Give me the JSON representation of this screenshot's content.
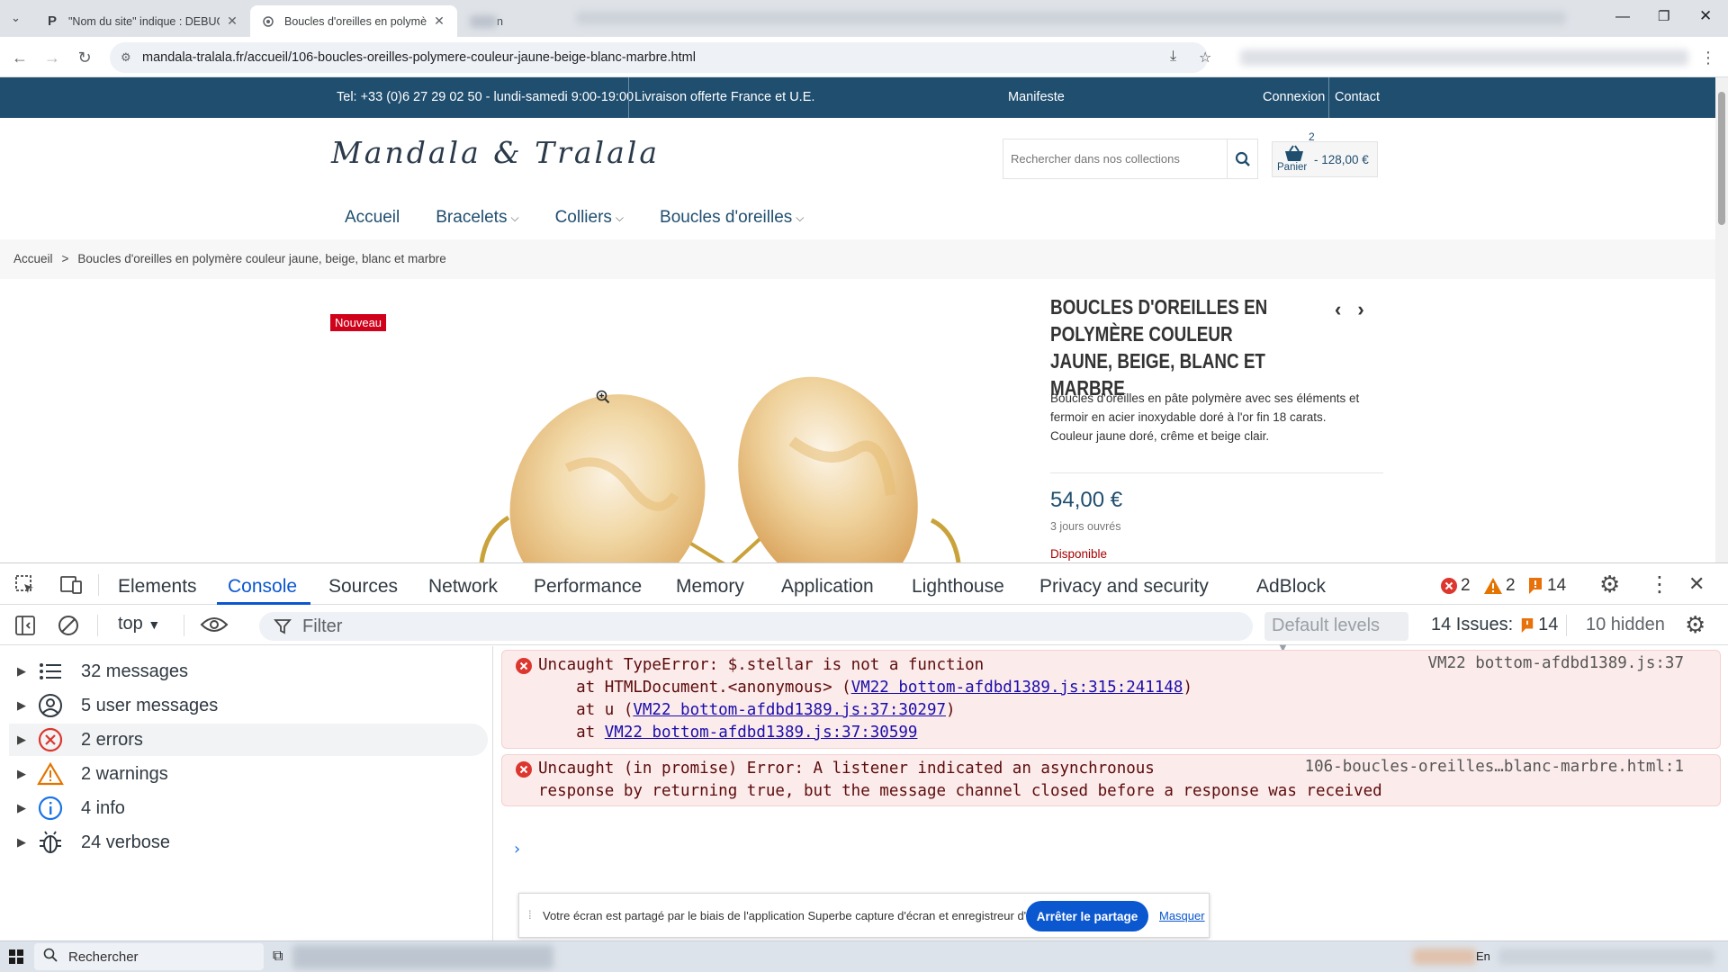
{
  "browser": {
    "tabs": [
      {
        "title": "\"Nom du site\" indique : DEBUG",
        "favicon": "P",
        "active": false
      },
      {
        "title": "Boucles d'oreilles en polymère c",
        "favicon": "globe",
        "active": true
      }
    ],
    "new_tab_partial": "n",
    "url": "mandala-tralala.fr/accueil/106-boucles-oreilles-polymere-couleur-jaune-beige-blanc-marbre.html"
  },
  "site": {
    "topbar": {
      "phone": "Tel: +33 (0)6 27 29 02 50 - lundi-samedi 9:00-19:00",
      "shipping": "Livraison offerte France et U.E.",
      "manifesto": "Manifeste",
      "login": "Connexion",
      "contact": "Contact"
    },
    "logo": "Mandala & Tralala",
    "search_placeholder": "Rechercher dans nos collections",
    "cart": {
      "count": "2",
      "label": "Panier",
      "total": "- 128,00 €"
    },
    "nav": [
      {
        "label": "Accueil",
        "dropdown": false
      },
      {
        "label": "Bracelets",
        "dropdown": true
      },
      {
        "label": "Colliers",
        "dropdown": true
      },
      {
        "label": "Boucles d'oreilles",
        "dropdown": true
      }
    ],
    "breadcrumb": {
      "home": "Accueil",
      "separator": ">",
      "current": "Boucles d'oreilles en polymère couleur jaune, beige, blanc et marbre"
    },
    "product": {
      "badge": "Nouveau",
      "title": "Boucles d'oreilles en polymère couleur jaune, beige, blanc et marbre",
      "description_1": "Boucles d'oreilles en pâte polymère avec ses éléments et",
      "description_2": "fermoir en acier inoxydable doré à l'or fin 18 carats.",
      "description_3": "Couleur jaune doré, crême et beige clair.",
      "price": "54,00 €",
      "delivery": "3 jours ouvrés",
      "availability": "Disponible"
    }
  },
  "devtools": {
    "tabs": [
      "Elements",
      "Console",
      "Sources",
      "Network",
      "Performance",
      "Memory",
      "Application",
      "Lighthouse",
      "Privacy and security",
      "AdBlock"
    ],
    "active_tab": "Console",
    "error_count": "2",
    "warning_count": "2",
    "issue_count": "14",
    "context": "top",
    "filter_placeholder": "Filter",
    "levels": "Default levels",
    "issues_label": "14 Issues:",
    "issues_num": "14",
    "hidden": "10 hidden",
    "sidebar": [
      {
        "label": "32 messages",
        "icon": "list-icon"
      },
      {
        "label": "5 user messages",
        "icon": "user-icon"
      },
      {
        "label": "2 errors",
        "icon": "error-icon"
      },
      {
        "label": "2 warnings",
        "icon": "warning-icon"
      },
      {
        "label": "4 info",
        "icon": "info-icon"
      },
      {
        "label": "24 verbose",
        "icon": "bug-icon"
      }
    ],
    "messages": [
      {
        "l1": "Uncaught TypeError: $.stellar is not a function",
        "l2_pre": "    at HTMLDocument.<anonymous> (",
        "l2_link": "VM22 bottom-afdbd1389.js:315:241148",
        "l2_post": ")",
        "l3_pre": "    at u (",
        "l3_link": "VM22 bottom-afdbd1389.js:37:30297",
        "l3_post": ")",
        "l4_pre": "    at ",
        "l4_link": "VM22 bottom-afdbd1389.js:37:30599",
        "source": "VM22 bottom-afdbd1389.js:37"
      },
      {
        "l1": "Uncaught (in promise) Error: A listener indicated an asynchronous",
        "l2": "response by returning true, but the message channel closed before a response was received",
        "source": "106-boucles-oreilles…blanc-marbre.html:1"
      }
    ]
  },
  "share_banner": {
    "text": "Votre écran est partagé par le biais de l'application Superbe capture d'écran et enregistreur d'écran.",
    "stop": "Arrêter le partage",
    "hide": "Masquer"
  },
  "taskbar": {
    "search": "Rechercher",
    "tray_text": "En"
  }
}
